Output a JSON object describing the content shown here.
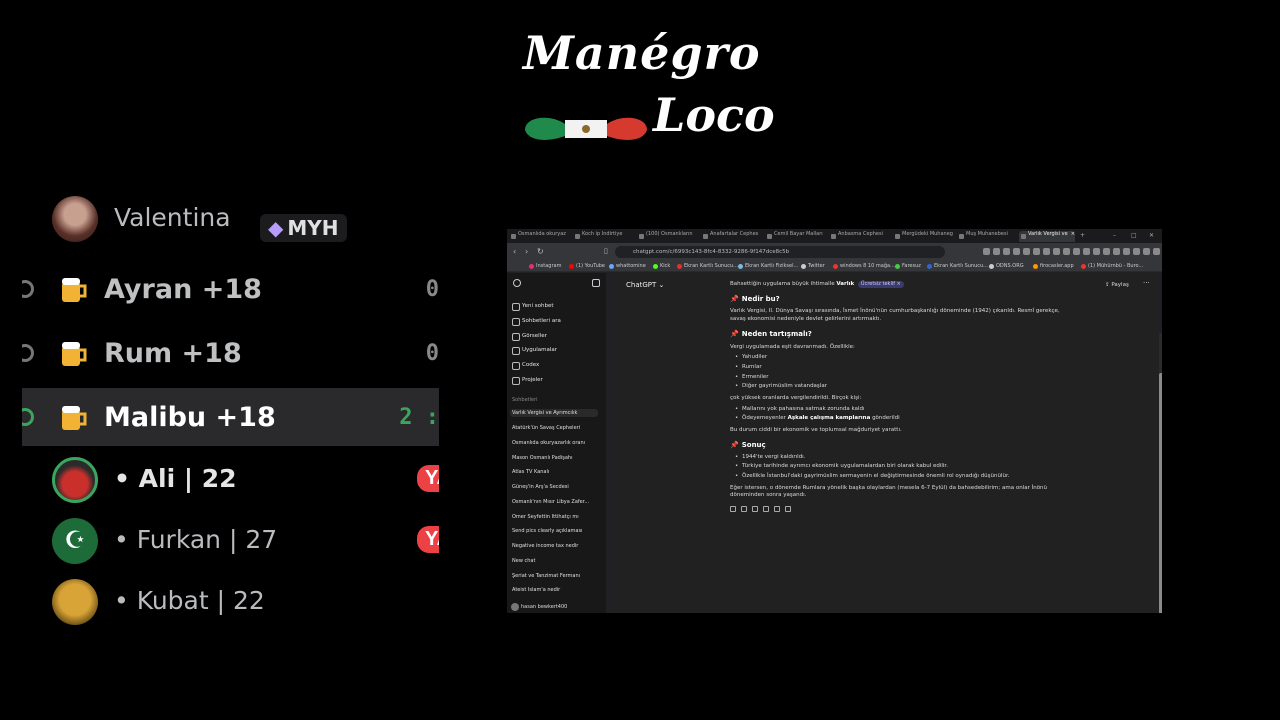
{
  "logo": {
    "line1": "Manégro",
    "line2": "Loco"
  },
  "voice": {
    "top_user": {
      "name": "Valentina",
      "tag": "MYH"
    },
    "channels": [
      {
        "name": "Ayran +18",
        "count": "0"
      },
      {
        "name": "Rum +18",
        "count": "0"
      },
      {
        "name": "Malibu +18",
        "count": "2 :"
      }
    ],
    "members": [
      {
        "name": "• Ali | 22",
        "badge": "YAY"
      },
      {
        "name": "• Furkan | 27",
        "badge": "YAY"
      },
      {
        "name": "• Kubat | 22",
        "badge": ""
      }
    ]
  },
  "browser": {
    "tabs": [
      "Osmanlıda okuryaz",
      "Koch ip İndirtiye",
      "(100) Osmanlıların",
      "Anafartalar Cephes",
      "Cemil Bayar Malları",
      "Anbasma Cephesi",
      "Mergüdeki Muhaneg",
      "Muş Muhanebesi",
      "Varlık Vergisi ve"
    ],
    "window_controls": {
      "new_tab": "+",
      "minimize": "–",
      "maximize": "□",
      "close": "✕"
    },
    "url": "chatgpt.com/c/6993c143-8fc4-8332-9286-9f147dce8c5b",
    "bookmarks": [
      {
        "label": "Instagram",
        "color": "#e1306c"
      },
      {
        "label": "(1) YouTube",
        "color": "#ff0000"
      },
      {
        "label": "whattomine",
        "color": "#6aa6ff"
      },
      {
        "label": "Kick",
        "color": "#53fc18"
      },
      {
        "label": "Ekran Kartlı Sunucu...",
        "color": "#d33"
      },
      {
        "label": "Ekran Kartlı Fiziksel...",
        "color": "#7bd"
      },
      {
        "label": "Twitter",
        "color": "#ccc"
      },
      {
        "label": "windows 8 10 mağa...",
        "color": "#e33"
      },
      {
        "label": "Faresuz",
        "color": "#4c4"
      },
      {
        "label": "Ekran Kartlı Sunucu...",
        "color": "#36c"
      },
      {
        "label": "ODNS.ORG",
        "color": "#ccc"
      },
      {
        "label": "firocasler.app",
        "color": "#f90"
      },
      {
        "label": "(1) Mühürnbü - Buro...",
        "color": "#e33"
      }
    ],
    "sidebar": {
      "items": [
        "Yeni sohbet",
        "Sohbetleri ara",
        "Görseller",
        "Uygulamalar",
        "Codex",
        "Projeler"
      ],
      "section": "Sohbetleri",
      "chats": [
        "Varlık Vergisi ve Ayrımcılık",
        "Atatürk'ün Savaş Cepheleri",
        "Osmanlıda okuryazarlık oranı",
        "Mason Osmanlı Padişahı",
        "Atlas TV Kanalı",
        "Güneş'in Arş'a Secdesi",
        "Osmanlı'nın Mısır Libya Zafer...",
        "Ömer Seyfettin İttihatçı mı",
        "Send pics clearly açıklaması",
        "Negative income tax nedir",
        "New chat",
        "Şeriat ve Tanzimat Fermanı",
        "Ateist İslam'a nedir"
      ],
      "user": "hasan bewkert400"
    },
    "main": {
      "model": "ChatGPT",
      "share": "Paylaş",
      "more": "···",
      "intro": "Bahsettiğin uygulama büyük ihtimalle",
      "intro_bold": "Varlık",
      "pill": "Ücretsiz teklif",
      "h1": "Nedir bu?",
      "p1": "Varlık Vergisi, II. Dünya Savaşı sırasında, İsmet İnönü'nün cumhurbaşkanlığı döneminde (1942) çıkarıldı. Resmî gerekçe, savaş ekonomisi nedeniyle devlet gelirlerini artırmaktı.",
      "h2": "Neden tartışmalı?",
      "p2": "Vergi uygulamada eşit davranmadı. Özellikle:",
      "list1": [
        "Yahudiler",
        "Rumlar",
        "Ermeniler",
        "Diğer gayrimüslim vatandaşlar"
      ],
      "p3": "çok yüksek oranlarda vergilendirildi. Birçok kişi:",
      "list2a": "Mallarını yok pahasına satmak zorunda kaldı",
      "list2b_pre": "Ödeyemeyenler",
      "list2b_bold": "Aşkale çalışma kamplarına",
      "list2b_post": "gönderildi",
      "p4": "Bu durum ciddi bir ekonomik ve toplumsal mağduriyet yarattı.",
      "h3": "Sonuç",
      "list3": [
        "1944'te vergi kaldırıldı.",
        "Türkiye tarihinde ayrımcı ekonomik uygulamalardan biri olarak kabul edilir.",
        "Özellikle İstanbul'daki gayrimüslim sermayenin el değiştirmesinde önemli rol oynadığı düşünülür."
      ],
      "p5": "Eğer istersen, o dönemde Rumlara yönelik başka olaylardan (mesela 6-7 Eylül) da bahsedebilirim; ama onlar İnönü döneminden sonra yaşandı.",
      "pin_icon": "📌"
    }
  }
}
